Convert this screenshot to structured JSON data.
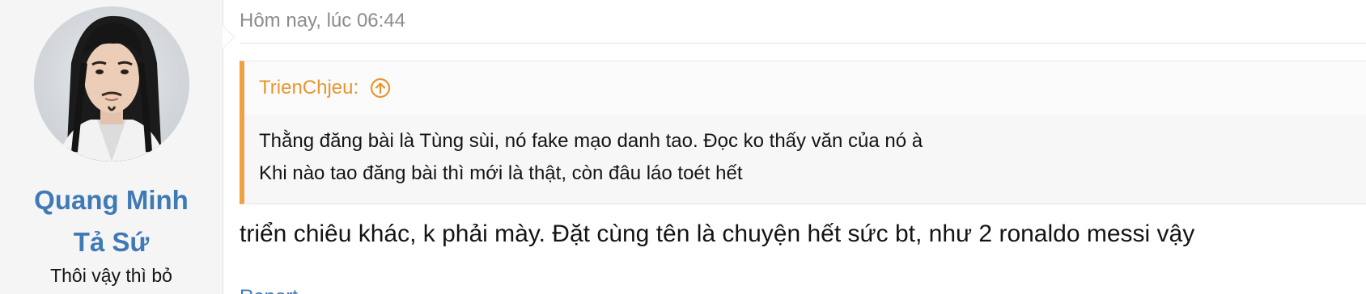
{
  "user": {
    "name_line1": "Quang Minh",
    "name_line2": "Tả Sứ",
    "title": "Thôi vậy thì bỏ"
  },
  "post": {
    "date": "Hôm nay, lúc 06:44",
    "quote": {
      "author": "TrienChjeu:",
      "icon": "arrow-up-circle-icon",
      "lines": [
        "Thằng đăng bài là Tùng sùi, nó fake mạo danh tao. Đọc ko thấy văn của nó à",
        "Khi nào tao đăng bài thì mới là thật, còn đâu láo toét hết"
      ]
    },
    "message": "triển chiêu khác, k phải mày. Đặt cùng tên là chuyện hết sức bt, như 2 ronaldo messi vậy",
    "footer_link": "Report"
  },
  "colors": {
    "username": "#3f7ab5",
    "quote_accent": "#f0a040",
    "quote_author": "#e8962e",
    "date": "#8c8c8c"
  }
}
